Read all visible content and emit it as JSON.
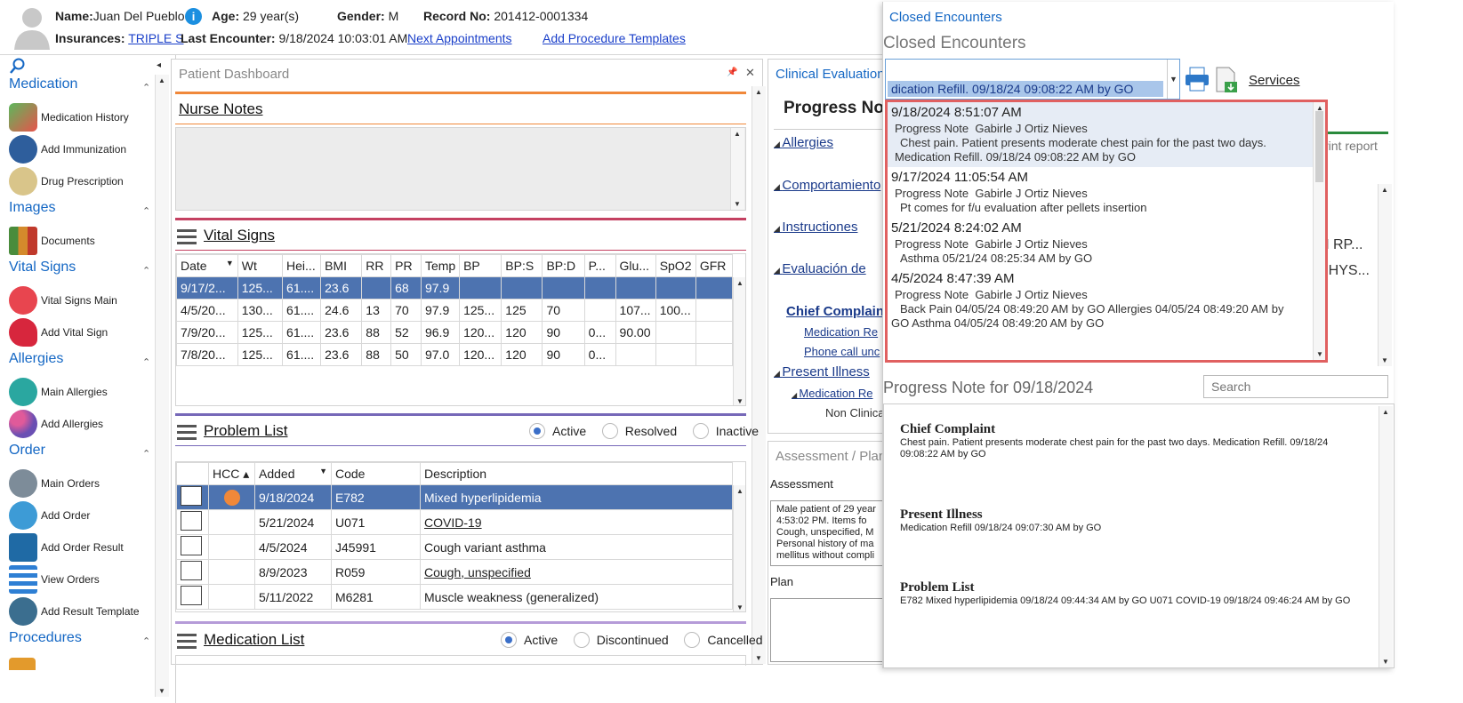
{
  "header": {
    "name_label": "Name:",
    "name_value": "Juan Del Pueblo",
    "age_label": "Age:",
    "age_value": "29 year(s)",
    "gender_label": "Gender:",
    "gender_value": "M",
    "record_label": "Record No:",
    "record_value": "201412-0001334",
    "insurances_label": "Insurances:",
    "insurances_value": "TRIPLE S",
    "last_encounter_label": "Last Encounter:",
    "last_encounter_value": "9/18/2024 10:03:01 AM",
    "next_appointments": "Next Appointments",
    "add_procedure_templates": "Add Procedure Templates"
  },
  "sidebar": {
    "sections": {
      "medication": "Medication",
      "images": "Images",
      "vital_signs": "Vital Signs",
      "allergies": "Allergies",
      "order": "Order",
      "procedures": "Procedures"
    },
    "items": {
      "medication_history": "Medication History",
      "add_immunization": "Add Immunization",
      "drug_prescription": "Drug Prescription",
      "documents": "Documents",
      "vital_signs_main": "Vital Signs Main",
      "add_vital_sign": "Add Vital Sign",
      "main_allergies": "Main Allergies",
      "add_allergies": "Add Allergies",
      "main_orders": "Main Orders",
      "add_order": "Add Order",
      "add_order_result": "Add Order Result",
      "view_orders": "View Orders",
      "add_result_template": "Add Result Template"
    }
  },
  "dashboard": {
    "title": "Patient Dashboard",
    "pin": "📌",
    "close": "✕",
    "nurse_notes": "Nurse Notes",
    "vital_signs": "Vital Signs",
    "vital_headers": [
      "Date",
      "Wt",
      "Hei...",
      "BMI",
      "RR",
      "PR",
      "Temp",
      "BP",
      "BP:S",
      "BP:D",
      "P...",
      "Glu...",
      "SpO2",
      "GFR"
    ],
    "vital_rows": [
      [
        "9/17/2...",
        "125...",
        "61....",
        "23.6",
        "",
        "68",
        "97.9",
        "",
        "",
        "",
        "",
        "",
        "",
        ""
      ],
      [
        "4/5/20...",
        "130...",
        "61....",
        "24.6",
        "13",
        "70",
        "97.9",
        "125...",
        "125",
        "70",
        "",
        "107...",
        "100...",
        ""
      ],
      [
        "7/9/20...",
        "125...",
        "61....",
        "23.6",
        "88",
        "52",
        "96.9",
        "120...",
        "120",
        "90",
        "0...",
        "90.00",
        "",
        ""
      ],
      [
        "7/8/20...",
        "125...",
        "61....",
        "23.6",
        "88",
        "50",
        "97.0",
        "120...",
        "120",
        "90",
        "0...",
        "",
        "",
        ""
      ]
    ],
    "problem_list": "Problem List",
    "problem_radios": [
      "Active",
      "Resolved",
      "Inactive"
    ],
    "problem_headers": [
      "",
      "HCC",
      "Added",
      "Code",
      "Description"
    ],
    "problem_rows": [
      {
        "added": "9/18/2024",
        "code": "E782",
        "desc": "Mixed hyperlipidemia",
        "hcc": true,
        "link": false
      },
      {
        "added": "5/21/2024",
        "code": "U071",
        "desc": "COVID-19",
        "hcc": false,
        "link": true
      },
      {
        "added": "4/5/2024",
        "code": "J45991",
        "desc": "Cough variant asthma",
        "hcc": false,
        "link": false
      },
      {
        "added": "8/9/2023",
        "code": "R059",
        "desc": "Cough, unspecified",
        "hcc": false,
        "link": true
      },
      {
        "added": "5/11/2022",
        "code": "M6281",
        "desc": "Muscle weakness (generalized)",
        "hcc": false,
        "link": false
      }
    ],
    "medication_list": "Medication List",
    "medication_radios": [
      "Active",
      "Discontinued",
      "Cancelled"
    ]
  },
  "clinical": {
    "title": "Clinical Evaluation",
    "progress_note": "Progress Note",
    "tree": [
      "Allergies",
      "Comportamiento",
      "Instructiones",
      "Evaluación de",
      "Chief Complaint",
      "Present Illness"
    ],
    "tree_sub": [
      "Medication Re",
      "Phone call unc",
      "Medication Re",
      "Non Clinica",
      "Phone call unc"
    ],
    "assessment_plan": "Assessment / Plan",
    "assessment": "Assessment",
    "assessment_text": "Male patient of 29 year 4:53:02 PM. Items fo Cough, unspecified, M Personal history of ma mellitus without compli",
    "plan": "Plan"
  },
  "closed": {
    "header_link": "Closed Encounters",
    "title": "Closed Encounters",
    "selected": "dication Refill.   09/18/24 09:08:22 AM by GO",
    "services": "Services",
    "right_behind": [
      "rint report",
      "N RP...",
      "PHYS..."
    ],
    "encounters": [
      {
        "date": "9/18/2024 8:51:07 AM",
        "type": "Progress Note",
        "doctor": "Gabirle J Ortiz Nieves",
        "line1": "Chest pain. Patient presents moderate chest pain for the past two days.",
        "line2": "Medication Refill.   09/18/24 09:08:22 AM by GO"
      },
      {
        "date": "9/17/2024 11:05:54 AM",
        "type": "Progress Note",
        "doctor": "Gabirle J Ortiz Nieves",
        "line1": "Pt comes for f/u evaluation after pellets insertion",
        "line2": ""
      },
      {
        "date": "5/21/2024 8:24:02 AM",
        "type": "Progress Note",
        "doctor": "Gabirle J Ortiz Nieves",
        "line1": "Asthma   05/21/24 08:25:34 AM by GO",
        "line2": ""
      },
      {
        "date": "4/5/2024 8:47:39 AM",
        "type": "Progress Note",
        "doctor": "Gabirle J Ortiz Nieves",
        "line1": "Back Pain   04/05/24 08:49:20 AM by GO   Allergies   04/05/24 08:49:20 AM by",
        "line2": "GO   Asthma   04/05/24 08:49:20 AM by GO"
      }
    ],
    "note_title": "Progress Note for 09/18/2024",
    "search_placeholder": "Search",
    "note_sections": [
      {
        "heading": "Chief Complaint",
        "body": "Chest pain. Patient presents moderate chest pain for the past two days. Medication Refill. 09/18/24 09:08:22 AM by GO"
      },
      {
        "heading": "Present Illness",
        "body": "Medication Refill 09/18/24 09:07:30 AM by GO"
      },
      {
        "heading": "Problem List",
        "body": "E782 Mixed hyperlipidemia 09/18/24 09:44:34 AM by GO U071 COVID-19 09/18/24 09:46:24 AM by GO"
      }
    ]
  },
  "colors": {
    "accent": "#1467c4",
    "selection": "#4d73b0",
    "highlight": "#e06060",
    "orange": "#f0883a"
  }
}
